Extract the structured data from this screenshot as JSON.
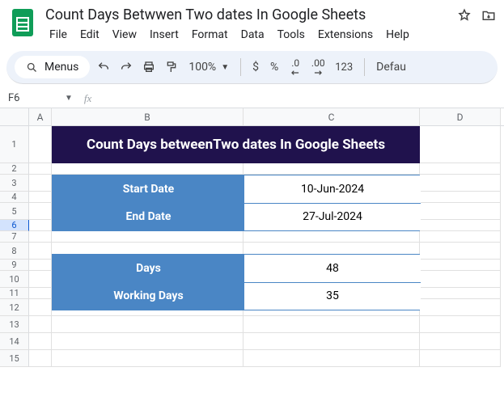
{
  "doc_title": "Count Days Betwwen Two dates In Google Sheets",
  "menubar": {
    "file": "File",
    "edit": "Edit",
    "view": "View",
    "insert": "Insert",
    "format": "Format",
    "data": "Data",
    "tools": "Tools",
    "extensions": "Extensions",
    "help": "Help"
  },
  "toolbar": {
    "menus": "Menus",
    "zoom": "100%",
    "currency": "$",
    "percent": "%",
    "decrease": ".0",
    "increase": ".00",
    "numfmt": "123",
    "font": "Defau"
  },
  "name_box": "F6",
  "columns": {
    "A": "A",
    "B": "B",
    "C": "C",
    "D": "D"
  },
  "row_labels": [
    "1",
    "2",
    "3",
    "4",
    "5",
    "6",
    "7",
    "8",
    "9",
    "10",
    "11",
    "12",
    "13",
    "14",
    "15"
  ],
  "sheet": {
    "banner": "Count Days betweenTwo dates In Google Sheets",
    "block1": {
      "label1": "Start Date",
      "value1": "10-Jun-2024",
      "label2": "End Date",
      "value2": "27-Jul-2024"
    },
    "block2": {
      "label1": "Days",
      "value1": "48",
      "label2": "Working Days",
      "value2": "35"
    }
  },
  "chart_data": {
    "type": "table",
    "title": "Count Days betweenTwo dates In Google Sheets",
    "rows": [
      {
        "label": "Start Date",
        "value": "10-Jun-2024"
      },
      {
        "label": "End Date",
        "value": "27-Jul-2024"
      },
      {
        "label": "Days",
        "value": 48
      },
      {
        "label": "Working Days",
        "value": 35
      }
    ]
  }
}
